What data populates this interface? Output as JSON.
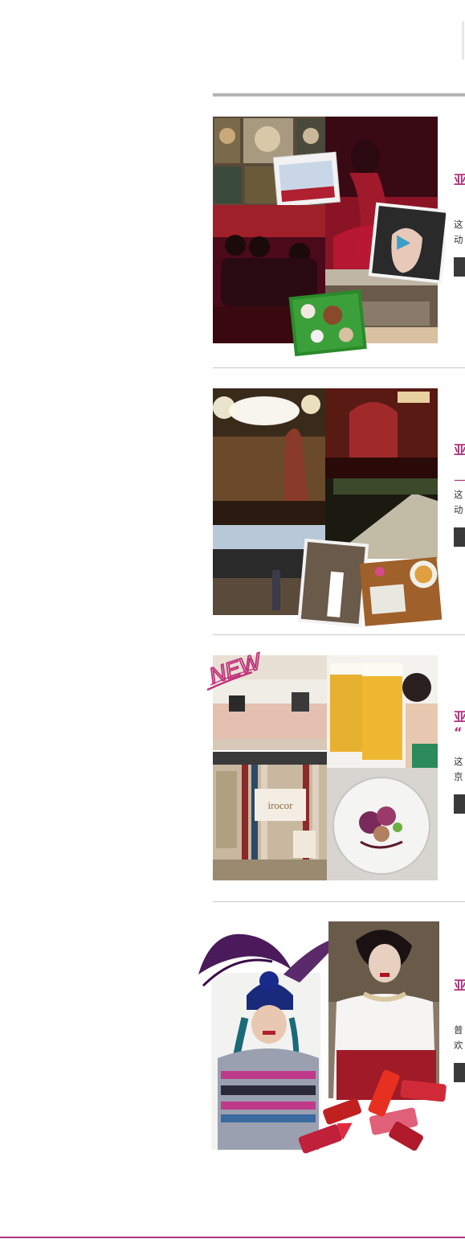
{
  "sections": [
    {
      "heading_line1": "亚",
      "heading_line2": "",
      "desc_line1": "这",
      "desc_line2": "动",
      "button_label": ""
    },
    {
      "heading_line1": "亚",
      "heading_line2": "—",
      "desc_line1": "这",
      "desc_line2": "动",
      "button_label": ""
    },
    {
      "badge": "NEW",
      "heading_line1": "亚",
      "heading_line2": "“",
      "desc_line1": "这",
      "desc_line2": "京",
      "button_label": "",
      "sign_text": "irocor"
    },
    {
      "heading_line1": "亚",
      "heading_line2": "",
      "desc_line1": "普",
      "desc_line2": "欢",
      "button_label": ""
    }
  ],
  "colors": {
    "accent": "#b0347c",
    "rule": "#b3b3b3",
    "button": "#3a3a3a",
    "text": "#333333"
  }
}
